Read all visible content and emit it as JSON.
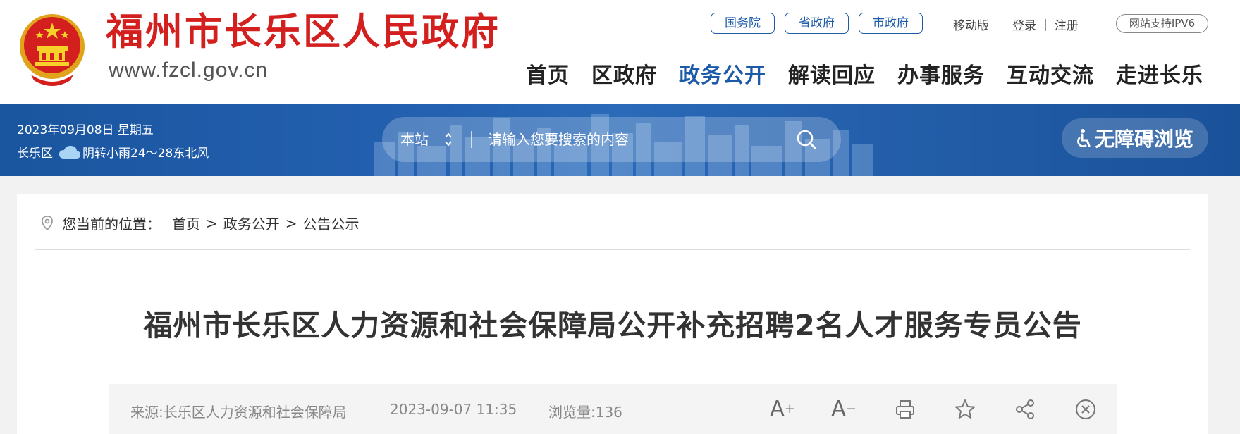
{
  "header": {
    "site_name": "福州市长乐区人民政府",
    "site_url": "www.fzcl.gov.cn",
    "gov_links": [
      "国务院",
      "省政府",
      "市政府"
    ],
    "top_links": {
      "mobile": "移动版",
      "login": "登录",
      "separator": "|",
      "register": "注册"
    },
    "ipv6_badge": "网站支持IPV6",
    "nav": [
      "首页",
      "区政府",
      "政务公开",
      "解读回应",
      "办事服务",
      "互动交流",
      "走进长乐"
    ],
    "active_nav": "政务公开",
    "brand_color": "#d41f1f",
    "accent_color": "#1d5aa8"
  },
  "banner": {
    "date": "2023年09月08日 星期五",
    "district": "长乐区",
    "weather": "阴转小雨24～28东北风",
    "weather_icon": "cloud-icon",
    "search_scope": "本站",
    "search_placeholder": "请输入您要搜索的内容",
    "accessibility_label": "无障碍浏览"
  },
  "breadcrumb": {
    "prefix": "您当前的位置：",
    "items": [
      "首页",
      "政务公开",
      "公告公示"
    ],
    "separator": ">"
  },
  "article": {
    "title": "福州市长乐区人力资源和社会保障局公开补充招聘2名人才服务专员公告",
    "source": "来源:长乐区人力资源和社会保障局",
    "datetime": "2023-09-07 11:35",
    "views": "浏览量:136",
    "tools": [
      "font-increase-icon",
      "font-decrease-icon",
      "print-icon",
      "star-icon",
      "share-icon",
      "close-icon"
    ]
  }
}
